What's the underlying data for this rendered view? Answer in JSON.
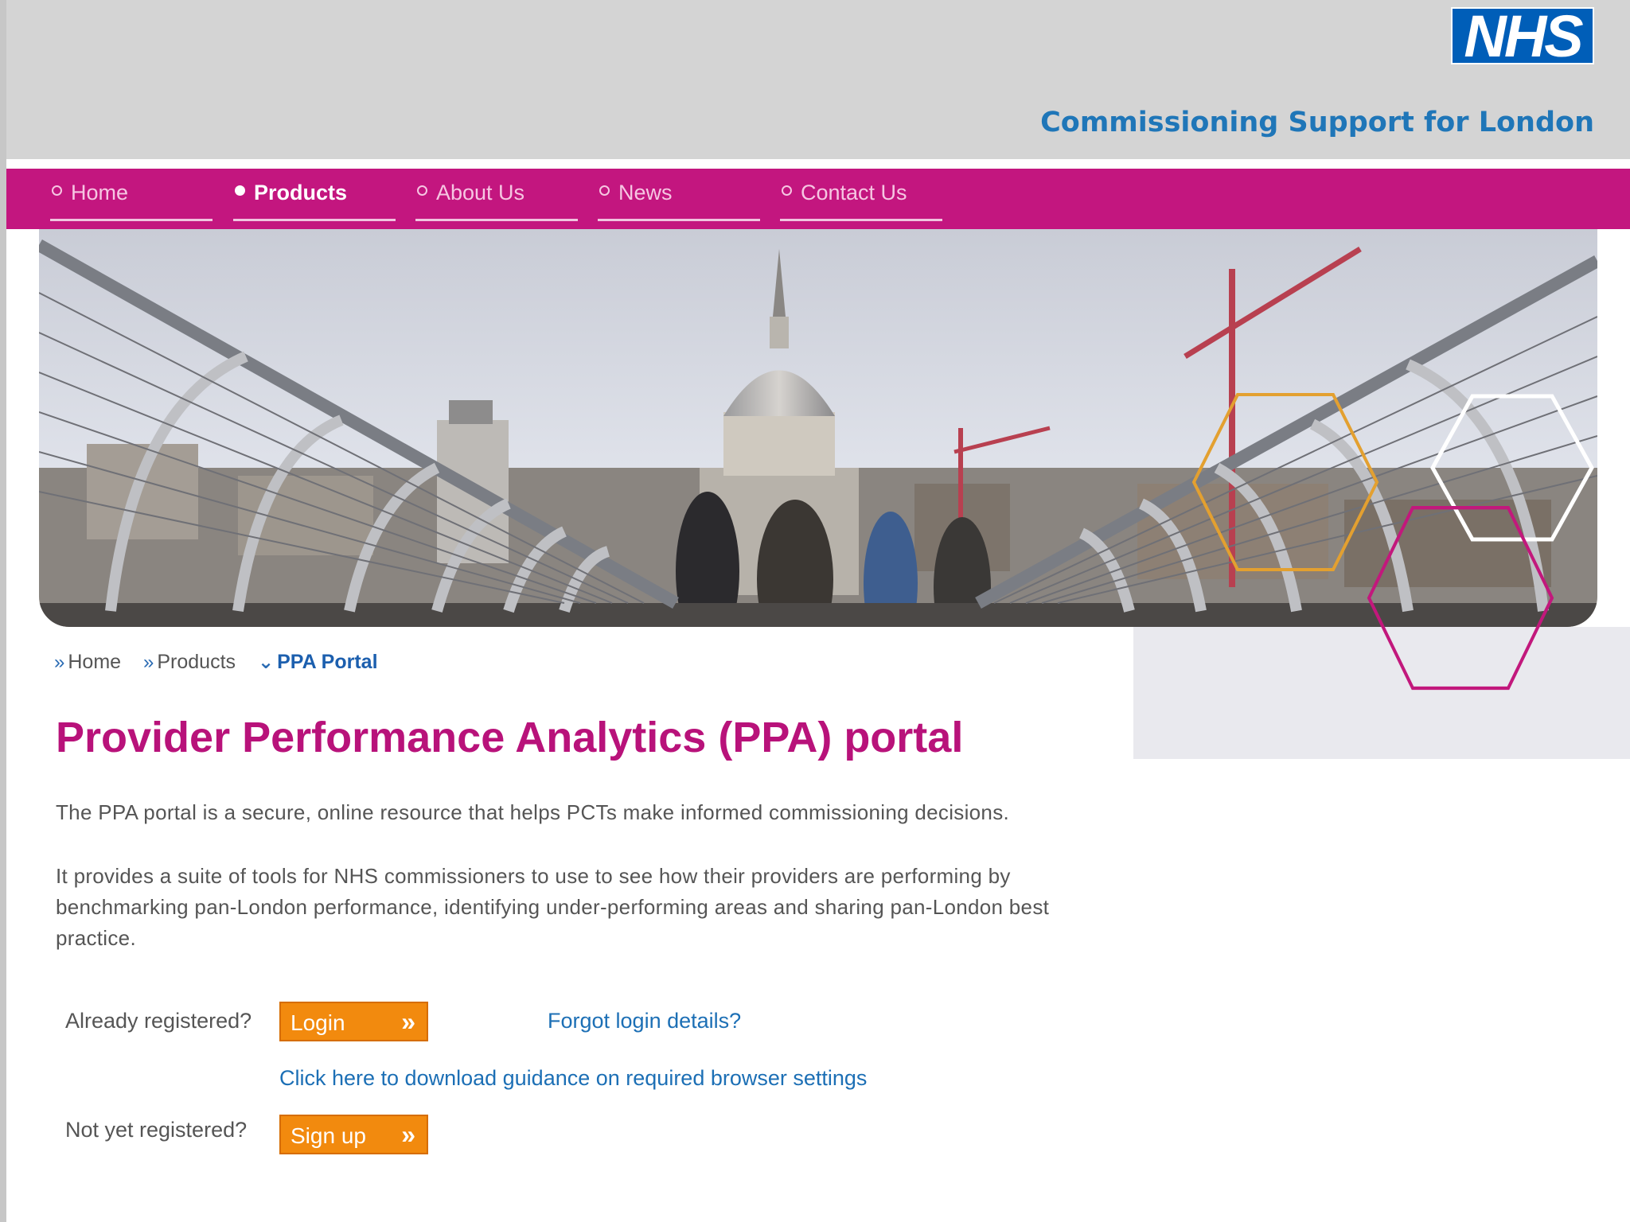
{
  "header": {
    "logo_text": "NHS",
    "org_name": "Commissioning Support for London"
  },
  "nav": {
    "items": [
      {
        "label": "Home",
        "active": false
      },
      {
        "label": "Products",
        "active": true
      },
      {
        "label": "About Us",
        "active": false
      },
      {
        "label": "News",
        "active": false
      },
      {
        "label": "Contact Us",
        "active": false
      }
    ]
  },
  "breadcrumb": {
    "items": [
      "Home",
      "Products",
      "PPA Portal"
    ]
  },
  "page": {
    "title": "Provider Performance Analytics (PPA) portal",
    "intro": "The PPA portal is a secure, online resource that helps PCTs make informed commissioning decisions.",
    "description": "It provides a suite of tools for NHS commissioners to use to see how their providers are performing by benchmarking pan-London performance, identifying under-performing areas and sharing pan-London best practice."
  },
  "login": {
    "registered_label": "Already registered?",
    "login_button": "Login",
    "forgot_link": "Forgot login details?",
    "guidance_link": "Click here to download guidance on required browser settings",
    "not_registered_label": "Not yet registered?",
    "signup_button": "Sign up"
  },
  "colors": {
    "brand_magenta": "#c3167f",
    "nhs_blue": "#005eb8",
    "button_orange": "#f28a0e",
    "link_blue": "#1c6fb5"
  }
}
